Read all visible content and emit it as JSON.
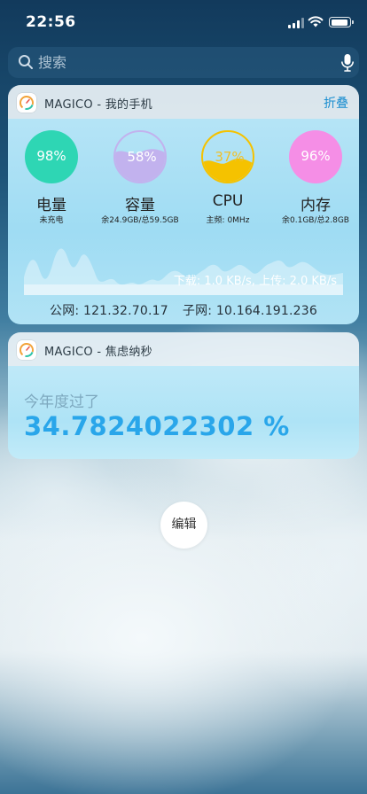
{
  "status_bar": {
    "time": "22:56"
  },
  "search": {
    "placeholder": "搜索"
  },
  "widget1": {
    "title": "MAGICO - 我的手机",
    "collapse_label": "折叠",
    "gauges": [
      {
        "percent": "98%",
        "level": 0.98,
        "name": "电量",
        "sub": "未充电",
        "color": "#2ed6b4"
      },
      {
        "percent": "58%",
        "level": 0.58,
        "name": "容量",
        "sub": "余24.9GB/总59.5GB",
        "color": "#c2b2ee"
      },
      {
        "percent": "37%",
        "level": 0.37,
        "name": "CPU",
        "sub": "主频: 0MHz",
        "color": "#f5c200"
      },
      {
        "percent": "96%",
        "level": 0.96,
        "name": "内存",
        "sub": "余0.1GB/总2.8GB",
        "color": "#f58ee6"
      }
    ],
    "speed": "下载: 1.0 KB/s, 上传: 2.0 KB/s",
    "public_ip": "公网: 121.32.70.17",
    "private_ip": "子网: 10.164.191.236"
  },
  "widget2": {
    "title": "MAGICO - 焦虑纳秒",
    "label": "今年度过了",
    "value": "34.7824022302 %"
  },
  "edit_label": "编辑",
  "colors": {
    "accent": "#1a8ed0",
    "year_value": "#29a6ea"
  }
}
